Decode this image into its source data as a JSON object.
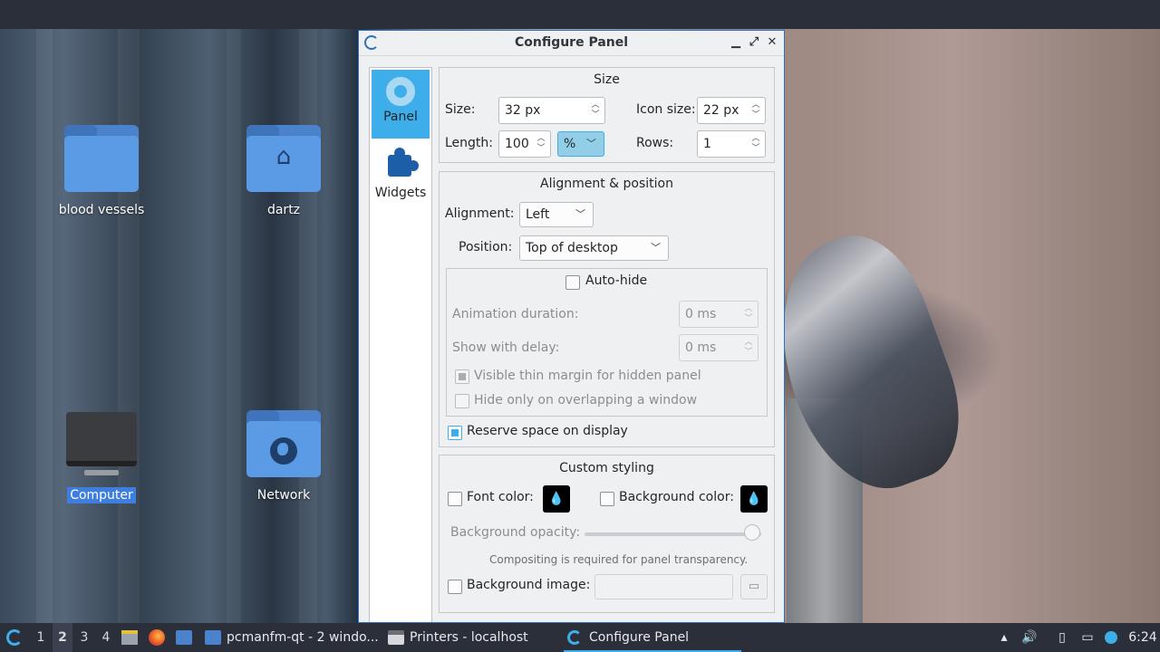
{
  "desktop": {
    "icons": [
      {
        "label": "blood vessels",
        "kind": "folder-icon"
      },
      {
        "label": "dartz",
        "kind": "home-folder-icon"
      },
      {
        "label": "Computer",
        "kind": "computer-icon",
        "selected": true
      },
      {
        "label": "Network",
        "kind": "network-folder-icon"
      }
    ]
  },
  "dialog": {
    "title": "Configure Panel",
    "buttons": {
      "minimize": "▁",
      "maximize": "⤢",
      "close": "✕"
    },
    "sidebar": [
      {
        "label": "Panel",
        "icon": "gear-icon",
        "active": true
      },
      {
        "label": "Widgets",
        "icon": "puzzle-icon",
        "active": false
      }
    ],
    "size": {
      "title": "Size",
      "size_label": "Size:",
      "size_value": "32 px",
      "icon_size_label": "Icon size:",
      "icon_size_value": "22 px",
      "length_label": "Length:",
      "length_value": "100",
      "length_unit": "%",
      "rows_label": "Rows:",
      "rows_value": "1"
    },
    "alignment": {
      "title": "Alignment & position",
      "alignment_label": "Alignment:",
      "alignment_value": "Left",
      "position_label": "Position:",
      "position_value": "Top of desktop",
      "autohide_label": "Auto-hide",
      "animation_label": "Animation duration:",
      "animation_value": "0 ms",
      "delay_label": "Show with delay:",
      "delay_value": "0 ms",
      "thin_margin_label": "Visible thin margin for hidden panel",
      "overlap_label": "Hide only on overlapping a window",
      "reserve_label": "Reserve space on display"
    },
    "styling": {
      "title": "Custom styling",
      "font_color_label": "Font color:",
      "bg_color_label": "Background color:",
      "opacity_label": "Background opacity:",
      "opacity_value": 1.0,
      "compositing_note": "Compositing is required for panel transparency.",
      "bg_image_label": "Background image:"
    }
  },
  "taskbar": {
    "workspaces": [
      "1",
      "2",
      "3",
      "4"
    ],
    "current_workspace": "2",
    "tasks": [
      {
        "label": "pcmanfm-qt - 2 windo...",
        "icon": "folder-icon"
      },
      {
        "label": "Printers - localhost",
        "icon": "printer-icon"
      },
      {
        "label": "Configure Panel",
        "icon": "lxqt-icon",
        "active": true
      }
    ],
    "clock": "6:24"
  },
  "colors": {
    "accent": "#3daee9",
    "window_bg": "#eff0f1",
    "taskbar_bg": "#2b2f3a"
  }
}
